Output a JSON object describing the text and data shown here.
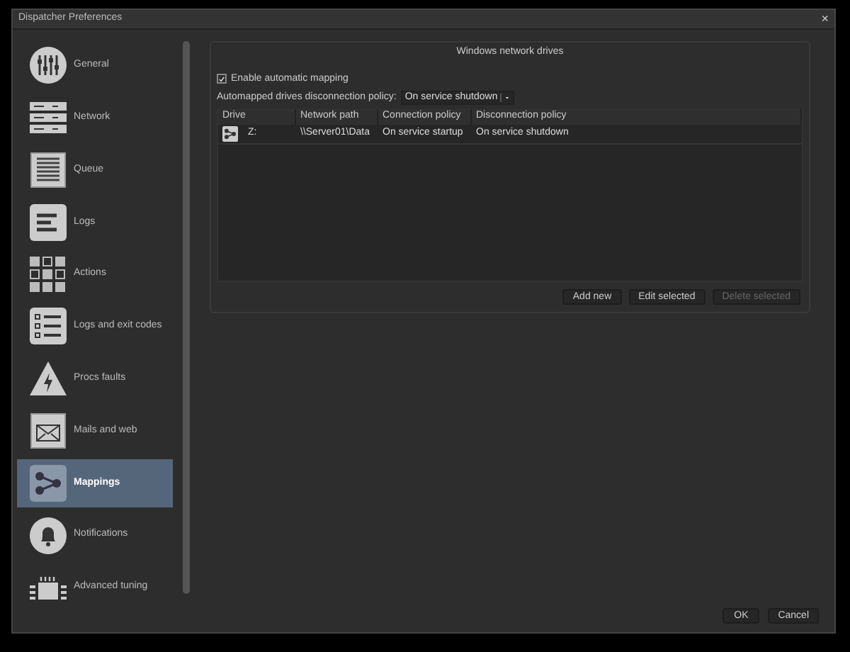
{
  "window": {
    "title": "Dispatcher Preferences",
    "close": "×"
  },
  "sidebar": {
    "items": [
      {
        "label": "General",
        "selected": false
      },
      {
        "label": "Network",
        "selected": false
      },
      {
        "label": "Queue",
        "selected": false
      },
      {
        "label": "Logs",
        "selected": false
      },
      {
        "label": "Actions",
        "selected": false
      },
      {
        "label": "Logs and exit codes",
        "selected": false
      },
      {
        "label": "Procs faults",
        "selected": false
      },
      {
        "label": "Mails and web",
        "selected": false
      },
      {
        "label": "Mappings",
        "selected": true
      },
      {
        "label": "Notifications",
        "selected": false
      },
      {
        "label": "Advanced tuning",
        "selected": false
      }
    ]
  },
  "group": {
    "title": "Windows network drives",
    "enable": {
      "label": "Enable automatic mapping",
      "checked": true
    },
    "policy": {
      "label": "Automapped drives disconnection policy:",
      "value": "On service shutdown"
    },
    "table": {
      "columns": [
        "Drive",
        "Network path",
        "Connection policy",
        "Disconnection policy"
      ],
      "rows": [
        {
          "cells": [
            "Z:",
            "\\\\Server01\\Data",
            "On service startup",
            "On service shutdown"
          ]
        }
      ]
    },
    "buttons": [
      {
        "label": "Add new",
        "disabled": false
      },
      {
        "label": "Edit selected",
        "disabled": false
      },
      {
        "label": "Delete selected",
        "disabled": true
      }
    ]
  },
  "footer": {
    "buttons": [
      "OK",
      "Cancel"
    ]
  }
}
